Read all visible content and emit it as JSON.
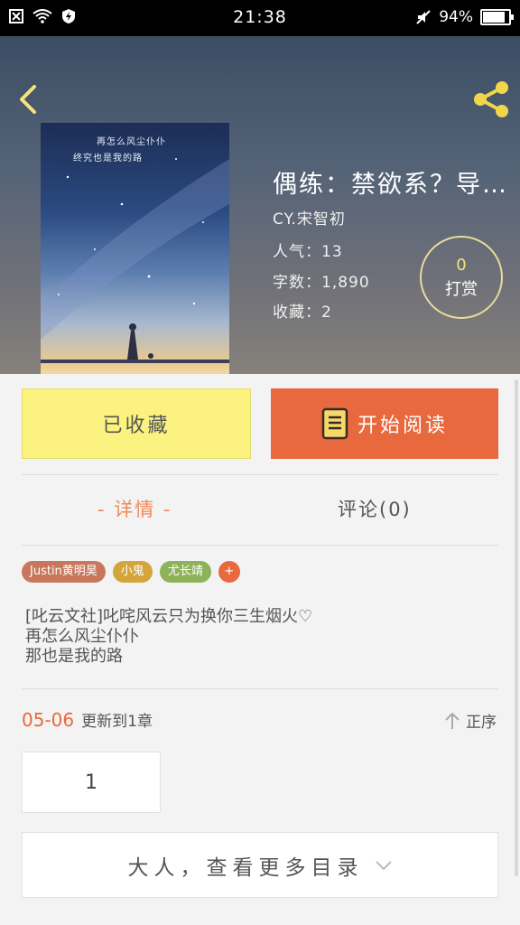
{
  "status_bar": {
    "time": "21:38",
    "battery_text": "94%",
    "battery_level": 0.94,
    "icons": [
      "close-box-icon",
      "wifi-icon",
      "shield-icon",
      "mute-icon",
      "battery-icon"
    ]
  },
  "hero": {
    "book_title": "偶练：禁欲系？导…",
    "author": "CY.宋智初",
    "popularity": "人气：13",
    "word_count": "字数：1,890",
    "favorites": "收藏：2",
    "reward_count": "0",
    "reward_label": "打赏",
    "cover_text_line1": "再怎么风尘仆仆",
    "cover_text_line2": "终究也是我的路"
  },
  "actions": {
    "collected_label": "已收藏",
    "start_reading_label": "开始阅读"
  },
  "tabs": {
    "detail": "- 详情 -",
    "comments": "评论(0)"
  },
  "tags": [
    {
      "label": "Justin黄明昊",
      "color": "#c9775c"
    },
    {
      "label": "小鬼",
      "color": "#d4a53a"
    },
    {
      "label": "尤长靖",
      "color": "#8db25a"
    },
    {
      "label": "+",
      "color": "#e8693e"
    }
  ],
  "description": [
    "[叱云文社]叱咤风云只为换你三生烟火♡",
    "再怎么风尘仆仆",
    "那也是我的路"
  ],
  "update": {
    "date": "05-06",
    "text": "更新到1章",
    "order_label": "正序"
  },
  "chapters": {
    "first": "1",
    "more_label": "大人，查看更多目录"
  },
  "colors": {
    "accent": "#e8693e",
    "collect_yellow": "#fbf27f",
    "reward_gold": "#f6e27a",
    "share_gold": "#f1d64a"
  }
}
